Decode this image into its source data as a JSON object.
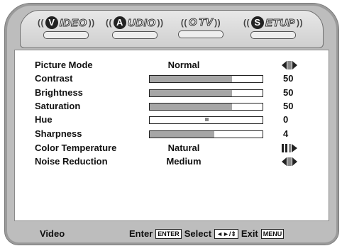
{
  "tabs": [
    {
      "label": "VIDEO",
      "badge": "V",
      "rest": "IDEO",
      "active": true
    },
    {
      "label": "AUDIO",
      "badge": "A",
      "rest": "UDIO"
    },
    {
      "label": "TV",
      "badge": "O",
      "rest": "TV"
    },
    {
      "label": "SETUP",
      "badge": "S",
      "rest": "ETUP"
    }
  ],
  "menu": {
    "rows": [
      {
        "label": "Picture Mode",
        "value": "Normal",
        "icon": "left-right-arrows-icon"
      },
      {
        "label": "Contrast",
        "value": "50",
        "level": 0.73
      },
      {
        "label": "Brightness",
        "value": "50",
        "level": 0.73
      },
      {
        "label": "Saturation",
        "value": "50",
        "level": 0.73
      },
      {
        "label": "Hue",
        "value": "0",
        "marker": 0.5
      },
      {
        "label": "Sharpness",
        "value": "4",
        "level": 0.57
      },
      {
        "label": "Color Temperature",
        "value": "Natural",
        "icon": "right-arrow-bars-icon"
      },
      {
        "label": "Noise Reduction",
        "value": "Medium",
        "icon": "left-right-arrows-icon"
      }
    ]
  },
  "footer": {
    "section": "Video",
    "enter_text": "Enter",
    "enter_key": "ENTER",
    "select_text": "Select",
    "select_key": "◄►/⇕",
    "exit_text": "Exit",
    "exit_key": "MENU"
  }
}
